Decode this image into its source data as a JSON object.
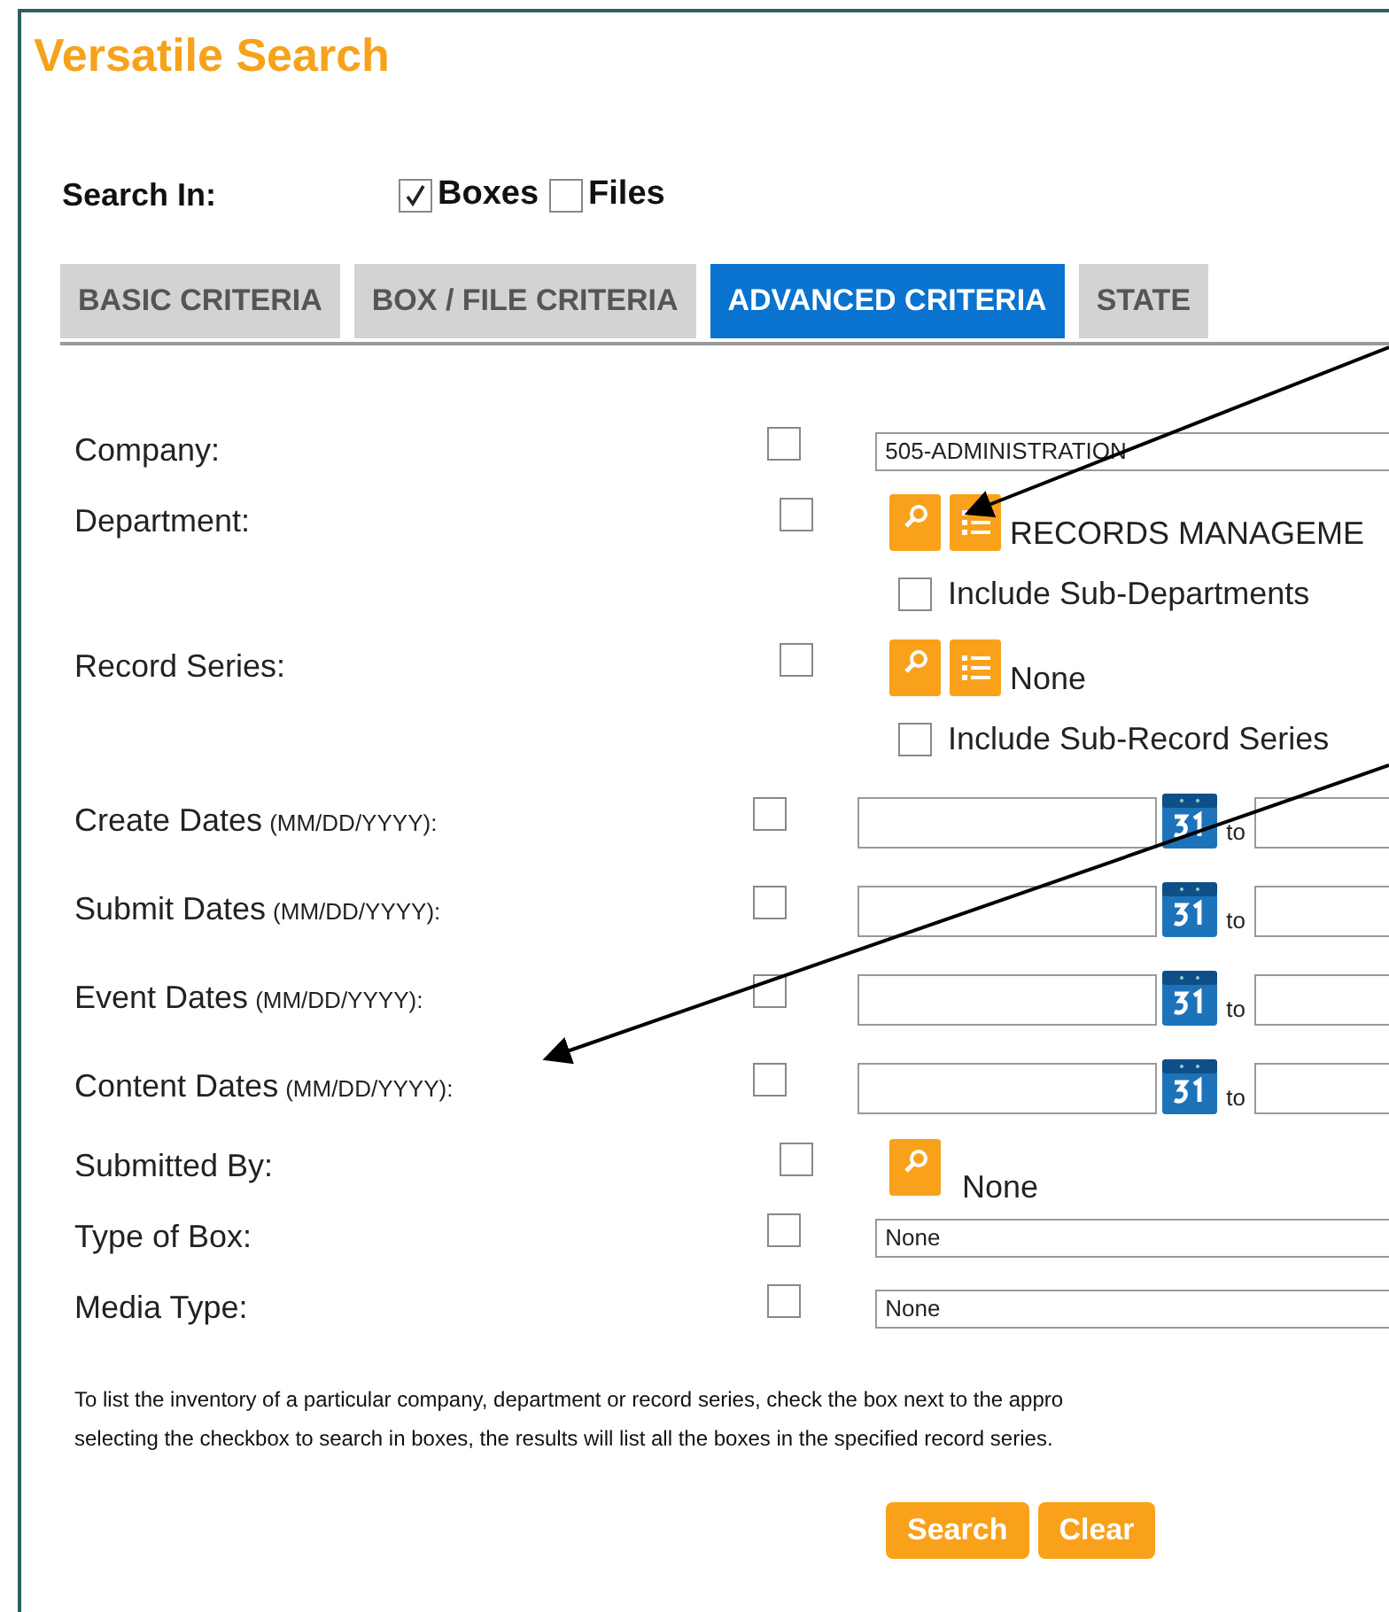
{
  "title": "Versatile Search",
  "search_in": {
    "label": "Search In:",
    "options": [
      {
        "label": "Boxes",
        "checked": true
      },
      {
        "label": "Files",
        "checked": false
      }
    ]
  },
  "tabs": [
    {
      "label": "BASIC CRITERIA",
      "selected": false
    },
    {
      "label": "BOX / FILE CRITERIA",
      "selected": false
    },
    {
      "label": "ADVANCED CRITERIA",
      "selected": true
    },
    {
      "label": "STATE",
      "selected": false
    }
  ],
  "criteria": [
    {
      "kind": "select",
      "label": "Company:",
      "checked": false,
      "value": "505-ADMINISTRATION"
    },
    {
      "kind": "picker",
      "label": "Department:",
      "checked": false,
      "value": "RECORDS MANAGEME",
      "sub_option": {
        "label": "Include Sub-Departments",
        "checked": false
      }
    },
    {
      "kind": "picker",
      "label": "Record Series:",
      "checked": false,
      "value": "None",
      "sub_option": {
        "label": "Include Sub-Record Series",
        "checked": false
      }
    },
    {
      "kind": "date",
      "label": "Create Dates",
      "hint": "(MM/DD/YYYY):",
      "checked": false,
      "separator": "to"
    },
    {
      "kind": "date",
      "label": "Submit Dates",
      "hint": "(MM/DD/YYYY):",
      "checked": false,
      "separator": "to"
    },
    {
      "kind": "date",
      "label": "Event Dates",
      "hint": "(MM/DD/YYYY):",
      "checked": false,
      "separator": "to"
    },
    {
      "kind": "date",
      "label": "Content Dates",
      "hint": "(MM/DD/YYYY):",
      "checked": false,
      "separator": "to"
    },
    {
      "kind": "user",
      "label": "Submitted By:",
      "checked": false,
      "value": "None"
    },
    {
      "kind": "select",
      "label": "Type of Box:",
      "checked": false,
      "value": "None"
    },
    {
      "kind": "select",
      "label": "Media Type:",
      "checked": false,
      "value": "None"
    }
  ],
  "note_lines": [
    "To list the inventory of a particular company, department or record series, check the box next to the appro",
    "selecting the checkbox to search in boxes, the results will list all the boxes in the specified record series."
  ],
  "buttons": [
    "Search",
    "Clear"
  ]
}
